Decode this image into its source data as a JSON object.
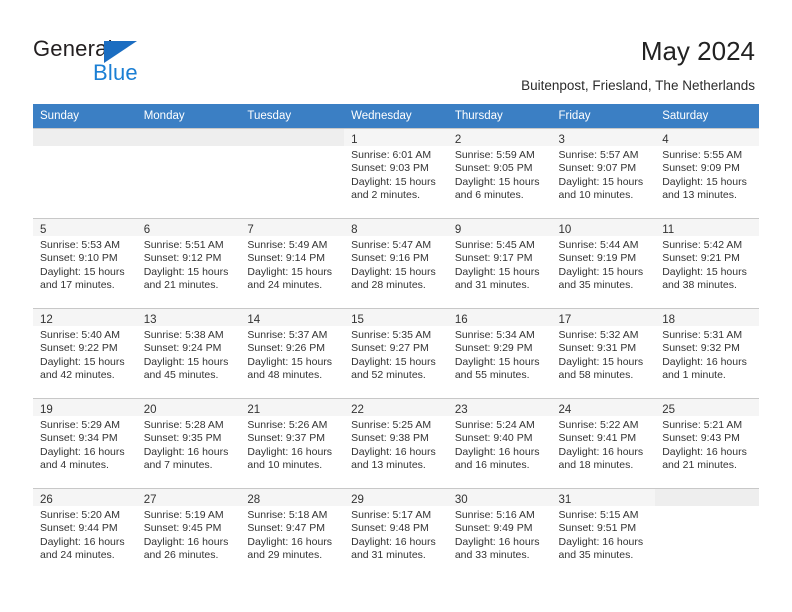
{
  "brand": {
    "name_top": "General",
    "name_bottom": "Blue",
    "accent_color": "#1b7fd4",
    "flag_color": "#1b6dc1"
  },
  "header": {
    "title": "May 2024",
    "subtitle": "Buitenpost, Friesland, The Netherlands"
  },
  "calendar": {
    "header_bg": "#3b7fc4",
    "weekday_headers": [
      "Sunday",
      "Monday",
      "Tuesday",
      "Wednesday",
      "Thursday",
      "Friday",
      "Saturday"
    ],
    "weeks": [
      [
        {
          "day": "",
          "sunrise": "",
          "sunset": "",
          "daylight": "",
          "empty": true
        },
        {
          "day": "",
          "sunrise": "",
          "sunset": "",
          "daylight": "",
          "empty": true
        },
        {
          "day": "",
          "sunrise": "",
          "sunset": "",
          "daylight": "",
          "empty": true
        },
        {
          "day": "1",
          "sunrise": "Sunrise: 6:01 AM",
          "sunset": "Sunset: 9:03 PM",
          "daylight": "Daylight: 15 hours and 2 minutes."
        },
        {
          "day": "2",
          "sunrise": "Sunrise: 5:59 AM",
          "sunset": "Sunset: 9:05 PM",
          "daylight": "Daylight: 15 hours and 6 minutes."
        },
        {
          "day": "3",
          "sunrise": "Sunrise: 5:57 AM",
          "sunset": "Sunset: 9:07 PM",
          "daylight": "Daylight: 15 hours and 10 minutes."
        },
        {
          "day": "4",
          "sunrise": "Sunrise: 5:55 AM",
          "sunset": "Sunset: 9:09 PM",
          "daylight": "Daylight: 15 hours and 13 minutes."
        }
      ],
      [
        {
          "day": "5",
          "sunrise": "Sunrise: 5:53 AM",
          "sunset": "Sunset: 9:10 PM",
          "daylight": "Daylight: 15 hours and 17 minutes."
        },
        {
          "day": "6",
          "sunrise": "Sunrise: 5:51 AM",
          "sunset": "Sunset: 9:12 PM",
          "daylight": "Daylight: 15 hours and 21 minutes."
        },
        {
          "day": "7",
          "sunrise": "Sunrise: 5:49 AM",
          "sunset": "Sunset: 9:14 PM",
          "daylight": "Daylight: 15 hours and 24 minutes."
        },
        {
          "day": "8",
          "sunrise": "Sunrise: 5:47 AM",
          "sunset": "Sunset: 9:16 PM",
          "daylight": "Daylight: 15 hours and 28 minutes."
        },
        {
          "day": "9",
          "sunrise": "Sunrise: 5:45 AM",
          "sunset": "Sunset: 9:17 PM",
          "daylight": "Daylight: 15 hours and 31 minutes."
        },
        {
          "day": "10",
          "sunrise": "Sunrise: 5:44 AM",
          "sunset": "Sunset: 9:19 PM",
          "daylight": "Daylight: 15 hours and 35 minutes."
        },
        {
          "day": "11",
          "sunrise": "Sunrise: 5:42 AM",
          "sunset": "Sunset: 9:21 PM",
          "daylight": "Daylight: 15 hours and 38 minutes."
        }
      ],
      [
        {
          "day": "12",
          "sunrise": "Sunrise: 5:40 AM",
          "sunset": "Sunset: 9:22 PM",
          "daylight": "Daylight: 15 hours and 42 minutes."
        },
        {
          "day": "13",
          "sunrise": "Sunrise: 5:38 AM",
          "sunset": "Sunset: 9:24 PM",
          "daylight": "Daylight: 15 hours and 45 minutes."
        },
        {
          "day": "14",
          "sunrise": "Sunrise: 5:37 AM",
          "sunset": "Sunset: 9:26 PM",
          "daylight": "Daylight: 15 hours and 48 minutes."
        },
        {
          "day": "15",
          "sunrise": "Sunrise: 5:35 AM",
          "sunset": "Sunset: 9:27 PM",
          "daylight": "Daylight: 15 hours and 52 minutes."
        },
        {
          "day": "16",
          "sunrise": "Sunrise: 5:34 AM",
          "sunset": "Sunset: 9:29 PM",
          "daylight": "Daylight: 15 hours and 55 minutes."
        },
        {
          "day": "17",
          "sunrise": "Sunrise: 5:32 AM",
          "sunset": "Sunset: 9:31 PM",
          "daylight": "Daylight: 15 hours and 58 minutes."
        },
        {
          "day": "18",
          "sunrise": "Sunrise: 5:31 AM",
          "sunset": "Sunset: 9:32 PM",
          "daylight": "Daylight: 16 hours and 1 minute."
        }
      ],
      [
        {
          "day": "19",
          "sunrise": "Sunrise: 5:29 AM",
          "sunset": "Sunset: 9:34 PM",
          "daylight": "Daylight: 16 hours and 4 minutes."
        },
        {
          "day": "20",
          "sunrise": "Sunrise: 5:28 AM",
          "sunset": "Sunset: 9:35 PM",
          "daylight": "Daylight: 16 hours and 7 minutes."
        },
        {
          "day": "21",
          "sunrise": "Sunrise: 5:26 AM",
          "sunset": "Sunset: 9:37 PM",
          "daylight": "Daylight: 16 hours and 10 minutes."
        },
        {
          "day": "22",
          "sunrise": "Sunrise: 5:25 AM",
          "sunset": "Sunset: 9:38 PM",
          "daylight": "Daylight: 16 hours and 13 minutes."
        },
        {
          "day": "23",
          "sunrise": "Sunrise: 5:24 AM",
          "sunset": "Sunset: 9:40 PM",
          "daylight": "Daylight: 16 hours and 16 minutes."
        },
        {
          "day": "24",
          "sunrise": "Sunrise: 5:22 AM",
          "sunset": "Sunset: 9:41 PM",
          "daylight": "Daylight: 16 hours and 18 minutes."
        },
        {
          "day": "25",
          "sunrise": "Sunrise: 5:21 AM",
          "sunset": "Sunset: 9:43 PM",
          "daylight": "Daylight: 16 hours and 21 minutes."
        }
      ],
      [
        {
          "day": "26",
          "sunrise": "Sunrise: 5:20 AM",
          "sunset": "Sunset: 9:44 PM",
          "daylight": "Daylight: 16 hours and 24 minutes."
        },
        {
          "day": "27",
          "sunrise": "Sunrise: 5:19 AM",
          "sunset": "Sunset: 9:45 PM",
          "daylight": "Daylight: 16 hours and 26 minutes."
        },
        {
          "day": "28",
          "sunrise": "Sunrise: 5:18 AM",
          "sunset": "Sunset: 9:47 PM",
          "daylight": "Daylight: 16 hours and 29 minutes."
        },
        {
          "day": "29",
          "sunrise": "Sunrise: 5:17 AM",
          "sunset": "Sunset: 9:48 PM",
          "daylight": "Daylight: 16 hours and 31 minutes."
        },
        {
          "day": "30",
          "sunrise": "Sunrise: 5:16 AM",
          "sunset": "Sunset: 9:49 PM",
          "daylight": "Daylight: 16 hours and 33 minutes."
        },
        {
          "day": "31",
          "sunrise": "Sunrise: 5:15 AM",
          "sunset": "Sunset: 9:51 PM",
          "daylight": "Daylight: 16 hours and 35 minutes."
        },
        {
          "day": "",
          "sunrise": "",
          "sunset": "",
          "daylight": "",
          "empty": true
        }
      ]
    ]
  }
}
